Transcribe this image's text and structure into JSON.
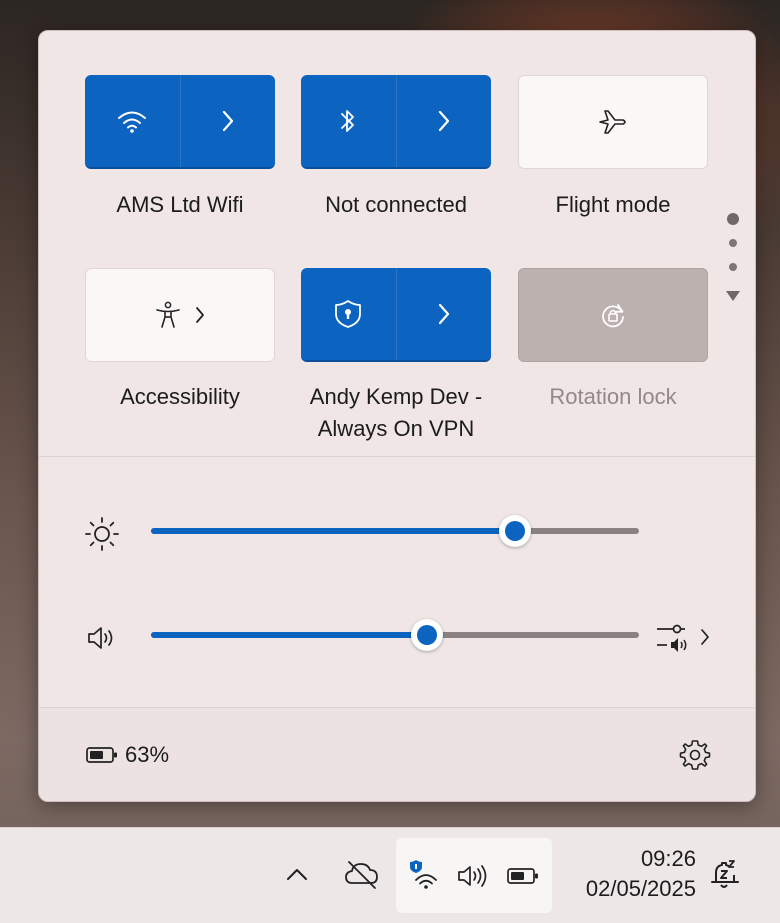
{
  "quick_settings": {
    "tiles": [
      {
        "label": "AMS Ltd Wifi",
        "icon": "wifi-icon",
        "state": "on"
      },
      {
        "label": "Not connected",
        "icon": "bluetooth-icon",
        "state": "on"
      },
      {
        "label": "Flight mode",
        "icon": "airplane-icon",
        "state": "off"
      },
      {
        "label": "Accessibility",
        "icon": "accessibility-icon",
        "state": "off"
      },
      {
        "label_line1": "Andy Kemp Dev -",
        "label_line2": "Always On VPN",
        "icon": "vpn-shield-icon",
        "state": "on"
      },
      {
        "label": "Rotation lock",
        "icon": "rotation-lock-icon",
        "state": "disabled"
      }
    ],
    "pages": {
      "count": 3,
      "current": 1
    },
    "brightness": {
      "icon": "brightness-icon",
      "value": 0.745
    },
    "volume": {
      "icon": "speaker-icon",
      "value": 0.565,
      "output_icon": "sound-output-icon"
    },
    "battery": {
      "icon": "battery-icon",
      "percent": "63%"
    },
    "settings_icon": "gear-icon"
  },
  "taskbar": {
    "chevron_icon": "chevron-up-icon",
    "onedrive_icon": "cloud-offline-icon",
    "tray_icons": [
      "vpn-wifi-icon",
      "volume-icon",
      "battery-icon"
    ],
    "time": "09:26",
    "date": "02/05/2025",
    "notification_icon": "notifications-snooze-icon"
  },
  "colors": {
    "accent": "#0c64c0",
    "panel": "#efe6e5",
    "taskbar": "#ede7e7"
  }
}
